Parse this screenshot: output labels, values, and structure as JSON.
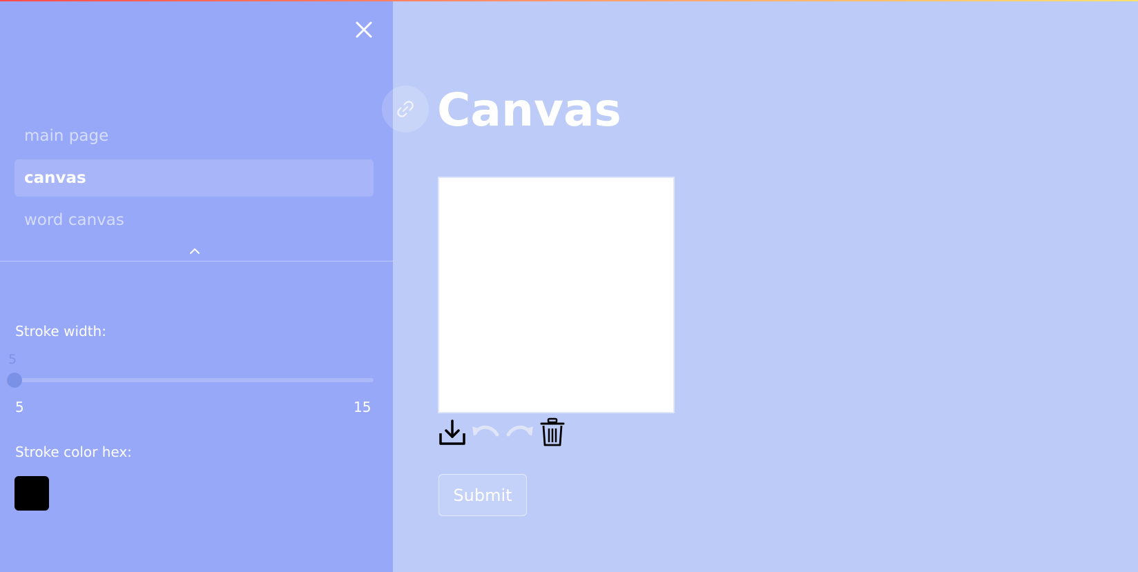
{
  "sidebar": {
    "nav_items": [
      {
        "label": "main page",
        "active": false
      },
      {
        "label": "canvas",
        "active": true
      },
      {
        "label": "word canvas",
        "active": false
      }
    ],
    "stroke_width": {
      "label": "Stroke width:",
      "value": "5",
      "min": "5",
      "max": "15"
    },
    "stroke_color": {
      "label": "Stroke color hex:",
      "value": "#000000"
    }
  },
  "main": {
    "title": "Canvas",
    "submit_label": "Submit"
  },
  "colors": {
    "sidebar_bg": "#97a8f8",
    "main_bg": "#bccbf7",
    "accent": "#7b91e6"
  },
  "icons": [
    "close-icon",
    "chevron-up-icon",
    "link-icon",
    "download-icon",
    "undo-icon",
    "redo-icon",
    "trash-icon"
  ]
}
